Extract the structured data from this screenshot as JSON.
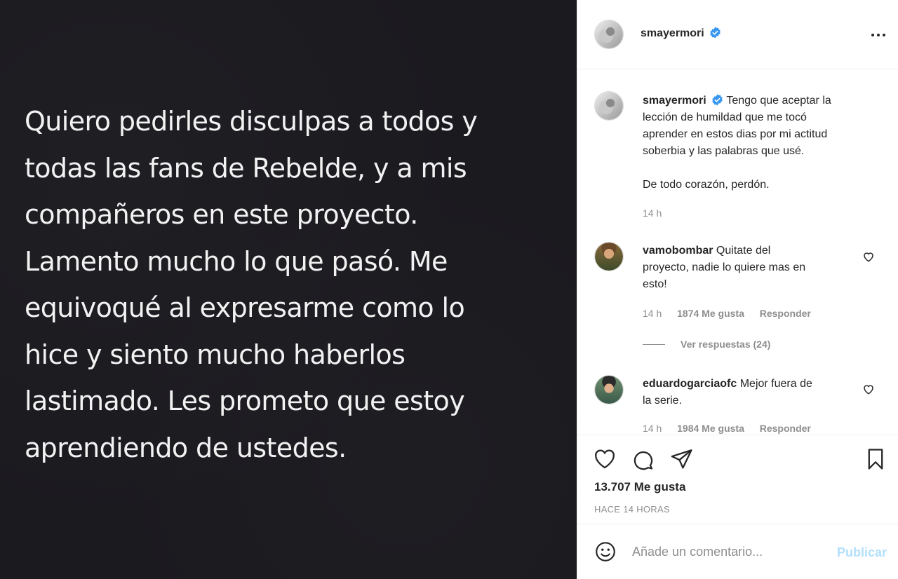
{
  "post": {
    "text_lines": [
      "Quiero pedirles disculpas a todos y",
      "todas las fans de Rebelde, y a mis",
      "compañeros en este proyecto.",
      "Lamento mucho lo que pasó. Me",
      "equivoqué al expresarme como lo",
      "hice y siento mucho haberlos",
      "lastimado. Les prometo que estoy",
      "aprendiendo de ustedes."
    ]
  },
  "header": {
    "username": "smayermori",
    "more_icon": "more-horizontal-icon"
  },
  "caption": {
    "username": "smayermori",
    "text_lines": [
      "Tengo que aceptar la",
      "lección de humildad que me tocó",
      "aprender en estos dias por mi actitud",
      "soberbia y las palabras que usé."
    ],
    "text_2": "De todo corazón, perdón.",
    "time": "14 h"
  },
  "comments": [
    {
      "username": "vamobombar",
      "text_lines": [
        "Quitate del",
        "proyecto, nadie lo quiere mas en",
        "esto!"
      ],
      "time": "14 h",
      "likes": "1874 Me gusta",
      "reply": "Responder",
      "view_replies": "Ver respuestas (24)"
    },
    {
      "username": "eduardogarciaofc",
      "text_lines": [
        "Mejor fuera de",
        "la serie."
      ],
      "time": "14 h",
      "likes": "1984 Me gusta",
      "reply": "Responder"
    }
  ],
  "actions": {
    "icons": [
      "heart-icon",
      "comment-icon",
      "share-icon",
      "bookmark-icon"
    ],
    "likes": "13.707 Me gusta",
    "time": "HACE 14 HORAS"
  },
  "add_comment": {
    "placeholder": "Añade un comentario...",
    "publish": "Publicar"
  },
  "colors": {
    "post_background": "#1b1a1f",
    "verified_blue": "#3897f0",
    "publish_disabled": "#b2dffc"
  }
}
